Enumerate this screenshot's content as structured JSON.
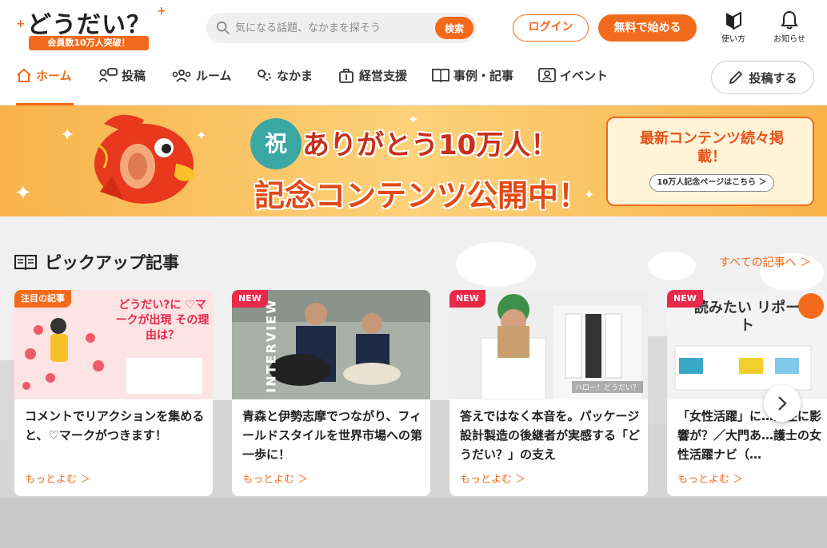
{
  "header": {
    "logo_text": "どうだい？",
    "logo_badge": "会員数10万人突破！",
    "search_placeholder": "気になる話題、なかまを探そう",
    "search_button": "検索",
    "login": "ログイン",
    "start_free": "無料で始める",
    "howto": "使い方",
    "notifications": "お知らせ"
  },
  "nav": {
    "items": [
      {
        "label": "ホーム",
        "icon": "home-icon",
        "active": true
      },
      {
        "label": "投稿",
        "icon": "post-icon"
      },
      {
        "label": "ルーム",
        "icon": "room-icon"
      },
      {
        "label": "なかま",
        "icon": "nakama-icon"
      },
      {
        "label": "経営支援",
        "icon": "support-icon"
      },
      {
        "label": "事例・記事",
        "icon": "book-icon"
      },
      {
        "label": "イベント",
        "icon": "event-icon"
      }
    ],
    "post_button": "投稿する"
  },
  "banner": {
    "celebrate": "祝",
    "line1": "ありがとう10万人！",
    "line2": "記念コンテンツ公開中！",
    "card_title": "最新コンテンツ続々掲載！",
    "card_link": "10万人記念ページはこちら ＞"
  },
  "pickup": {
    "title": "ピックアップ記事",
    "see_all": "すべての記事へ ＞",
    "articles": [
      {
        "tag": "注目の記事",
        "title": "コメントでリアクションを集めると、♡マークがつきます！",
        "more": "もっとよむ ＞",
        "img_text": "どうだい?に ♡マークが出現 その理由は？"
      },
      {
        "tag": "NEW",
        "title": "青森と伊勢志摩でつながり、フィールドスタイルを世界市場への第一歩に！",
        "more": "もっとよむ ＞",
        "img_text": "INTERVIEW"
      },
      {
        "tag": "NEW",
        "title": "答えではなく本音を。パッケージ設計製造の後継者が実感する「どうだい？」の支え",
        "more": "もっとよむ ＞",
        "img_text": "ハロー！どうだい？"
      },
      {
        "tag": "NEW",
        "title": "「女性活躍」に…が注に影響が？／大門あ…護士の女性活躍ナビ（…",
        "more": "もっとよむ ＞",
        "img_text": "読みたい リポート"
      }
    ]
  },
  "colors": {
    "accent": "#f26a1b",
    "new_tag": "#e8294a"
  }
}
